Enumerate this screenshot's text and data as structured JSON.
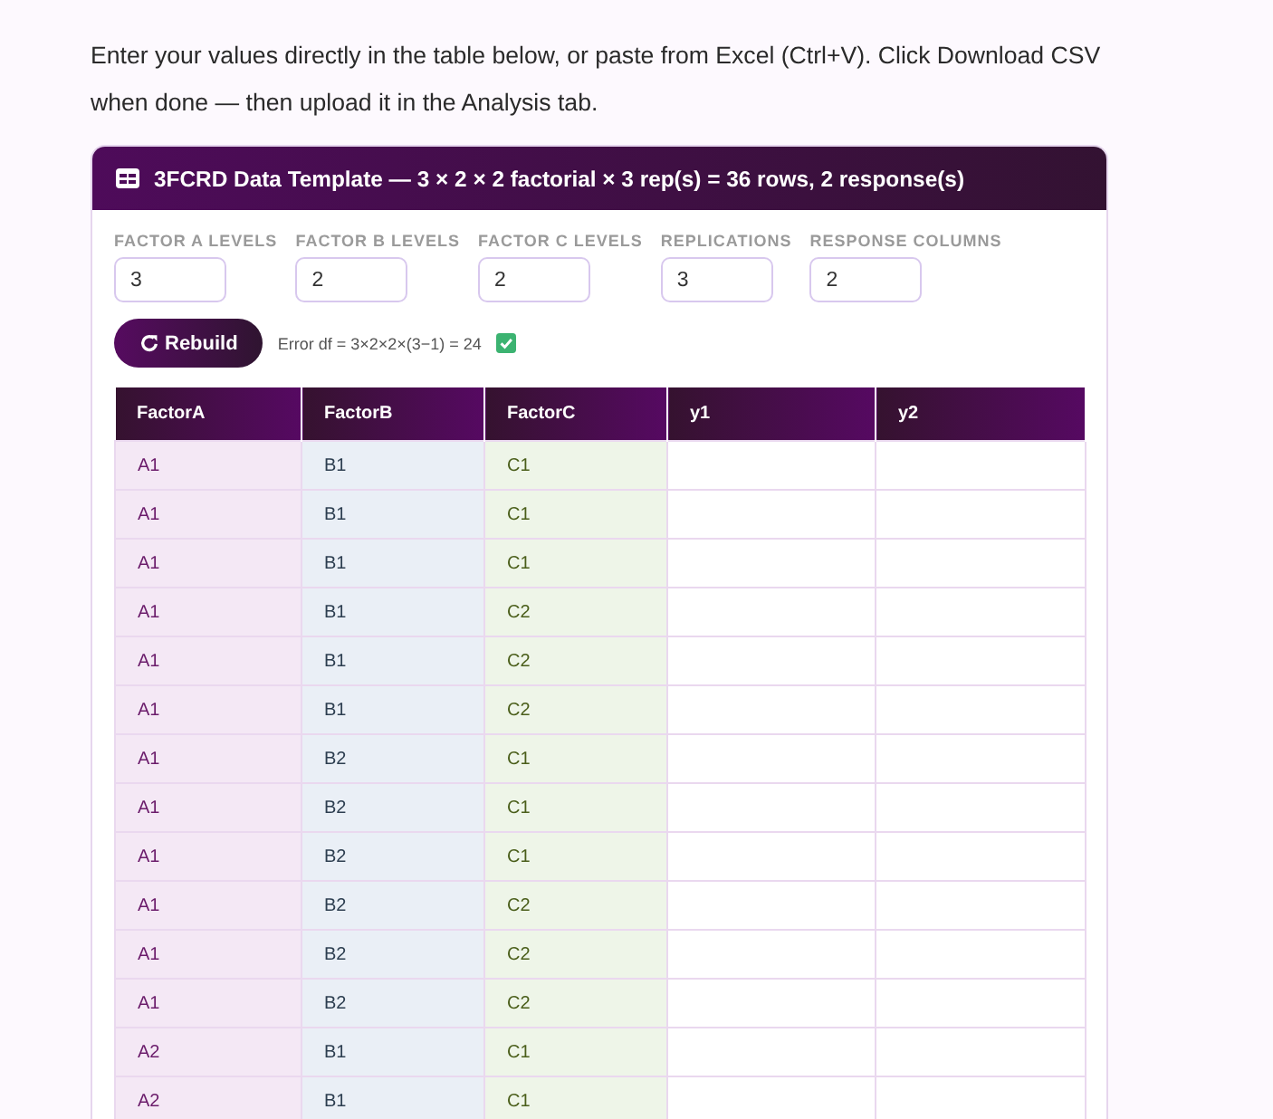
{
  "intro": "Enter your values directly in the table below, or paste from Excel (Ctrl+V). Click Download CSV when done — then upload it in the Analysis tab.",
  "card": {
    "title": "3FCRD Data Template — 3 × 2 × 2 factorial × 3 rep(s) = 36 rows, 2 response(s)"
  },
  "settings": [
    {
      "label": "FACTOR A LEVELS",
      "value": "3"
    },
    {
      "label": "FACTOR B LEVELS",
      "value": "2"
    },
    {
      "label": "FACTOR C LEVELS",
      "value": "2"
    },
    {
      "label": "REPLICATIONS",
      "value": "3"
    },
    {
      "label": "RESPONSE COLUMNS",
      "value": "2"
    }
  ],
  "rebuild_button": "Rebuild",
  "error_df": "Error df = 3×2×2×(3−1) = 24",
  "table": {
    "columns": [
      {
        "label": "FactorA",
        "kind": "a"
      },
      {
        "label": "FactorB",
        "kind": "b"
      },
      {
        "label": "FactorC",
        "kind": "c"
      },
      {
        "label": "y1",
        "kind": "response"
      },
      {
        "label": "y2",
        "kind": "response"
      }
    ],
    "rows": [
      [
        "A1",
        "B1",
        "C1",
        "",
        ""
      ],
      [
        "A1",
        "B1",
        "C1",
        "",
        ""
      ],
      [
        "A1",
        "B1",
        "C1",
        "",
        ""
      ],
      [
        "A1",
        "B1",
        "C2",
        "",
        ""
      ],
      [
        "A1",
        "B1",
        "C2",
        "",
        ""
      ],
      [
        "A1",
        "B1",
        "C2",
        "",
        ""
      ],
      [
        "A1",
        "B2",
        "C1",
        "",
        ""
      ],
      [
        "A1",
        "B2",
        "C1",
        "",
        ""
      ],
      [
        "A1",
        "B2",
        "C1",
        "",
        ""
      ],
      [
        "A1",
        "B2",
        "C2",
        "",
        ""
      ],
      [
        "A1",
        "B2",
        "C2",
        "",
        ""
      ],
      [
        "A1",
        "B2",
        "C2",
        "",
        ""
      ],
      [
        "A2",
        "B1",
        "C1",
        "",
        ""
      ],
      [
        "A2",
        "B1",
        "C1",
        "",
        ""
      ]
    ]
  }
}
